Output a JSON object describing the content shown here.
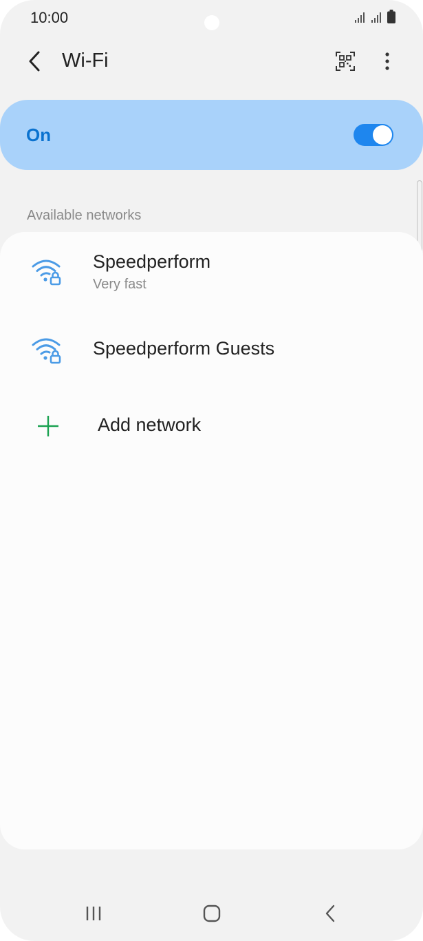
{
  "status_bar": {
    "time": "10:00",
    "icons": [
      "signal-icon",
      "signal-icon",
      "battery-icon"
    ]
  },
  "app_bar": {
    "title": "Wi-Fi",
    "icons": [
      "back-arrow-icon",
      "qr-code-icon",
      "more-vertical-icon"
    ]
  },
  "master_toggle": {
    "label": "On",
    "state": true,
    "accent": "#1e86ee",
    "background": "#a9d2fa"
  },
  "networks": {
    "header": "Available networks",
    "items": [
      {
        "name": "Speedperform",
        "subtitle": "Very fast",
        "icon": "wifi-locked-icon"
      },
      {
        "name": "Speedperform Guests",
        "subtitle": "",
        "icon": "wifi-locked-icon"
      }
    ],
    "add_label": "Add network",
    "add_color": "#1aa251"
  },
  "nav_bar": {
    "icons": [
      "recent-apps-icon",
      "home-icon",
      "back-icon"
    ]
  }
}
